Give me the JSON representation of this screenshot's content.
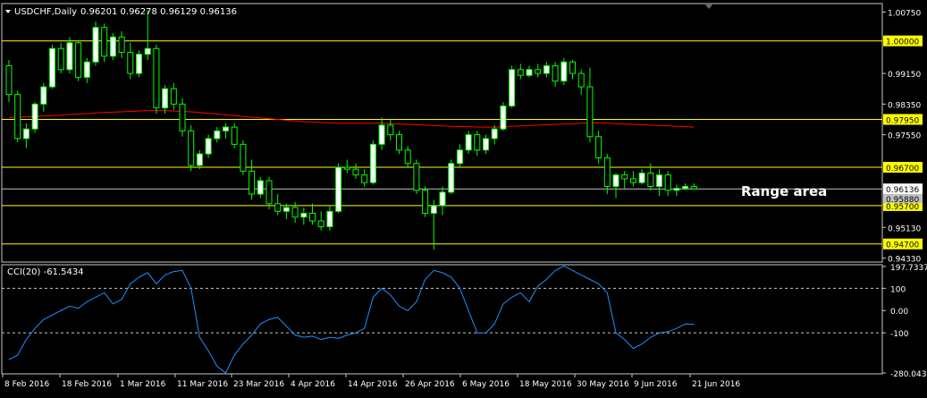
{
  "header": {
    "symbol_label": "USDCHF,Daily",
    "ohlc": "0.96201 0.96278 0.96129 0.96136",
    "menu_arrow": "triangle-down-icon"
  },
  "annotation": {
    "text": "Range area"
  },
  "colors": {
    "background": "#000000",
    "grid_border": "#c8c8c8",
    "bull_candle": "#ffffff",
    "bear_candle": "#000000",
    "candle_outline": "#00ff00",
    "moving_average": "#ff0000",
    "level_lines": "#ffff00",
    "price_line": "#c0c0c0",
    "cci_line": "#1e90ff",
    "text": "#ffffff"
  },
  "chart_data": [
    {
      "type": "candlestick",
      "title": "USDCHF,Daily",
      "ylim": [
        0.9425,
        1.0095
      ],
      "y_ticks": [
        "1.00750",
        "0.99150",
        "0.98350",
        "0.97550",
        "0.95130",
        "0.94330"
      ],
      "level_lines": [
        {
          "value": 1.0,
          "label": "1.00000"
        },
        {
          "value": 0.9795,
          "label": "0.97950"
        },
        {
          "value": 0.967,
          "label": "0.96700"
        },
        {
          "value": 0.957,
          "label": "0.95700"
        },
        {
          "value": 0.947,
          "label": "0.94700"
        }
      ],
      "current_price": {
        "value": 0.96136,
        "label": "0.96136"
      },
      "hidden_label": {
        "value": 0.9588,
        "label": "0.95880"
      },
      "x_labels": [
        "8 Feb 2016",
        "18 Feb 2016",
        "1 Mar 2016",
        "11 Mar 2016",
        "23 Mar 2016",
        "4 Apr 2016",
        "14 Apr 2016",
        "26 Apr 2016",
        "6 May 2016",
        "18 May 2016",
        "30 May 2016",
        "9 Jun 2016",
        "21 Jun 2016"
      ],
      "candles": [
        [
          0.9935,
          0.995,
          0.984,
          0.986
        ],
        [
          0.986,
          0.987,
          0.9735,
          0.9745
        ],
        [
          0.9745,
          0.9785,
          0.972,
          0.977
        ],
        [
          0.977,
          0.984,
          0.976,
          0.9835
        ],
        [
          0.9835,
          0.989,
          0.9815,
          0.988
        ],
        [
          0.988,
          0.999,
          0.9875,
          0.998
        ],
        [
          0.998,
          0.9995,
          0.9915,
          0.9925
        ],
        [
          0.9925,
          1.001,
          0.9915,
          0.9995
        ],
        [
          0.9995,
          1.0,
          0.9895,
          0.9905
        ],
        [
          0.9905,
          0.9955,
          0.989,
          0.9945
        ],
        [
          0.9945,
          1.005,
          0.9935,
          1.0035
        ],
        [
          1.0035,
          1.0045,
          0.9945,
          0.996
        ],
        [
          0.996,
          1.002,
          0.995,
          1.001
        ],
        [
          1.001,
          1.0025,
          0.9955,
          0.997
        ],
        [
          0.997,
          0.9995,
          0.99,
          0.9915
        ],
        [
          0.9915,
          0.9975,
          0.9905,
          0.9965
        ],
        [
          0.9965,
          1.008,
          0.995,
          0.998
        ],
        [
          0.998,
          0.999,
          0.981,
          0.9825
        ],
        [
          0.9825,
          0.9885,
          0.981,
          0.9875
        ],
        [
          0.9875,
          0.989,
          0.982,
          0.9835
        ],
        [
          0.9835,
          0.985,
          0.975,
          0.9765
        ],
        [
          0.9765,
          0.978,
          0.966,
          0.9675
        ],
        [
          0.9675,
          0.9715,
          0.9665,
          0.9705
        ],
        [
          0.9705,
          0.9755,
          0.9695,
          0.9745
        ],
        [
          0.9745,
          0.9775,
          0.9735,
          0.9765
        ],
        [
          0.9765,
          0.9785,
          0.9745,
          0.9775
        ],
        [
          0.9775,
          0.9785,
          0.972,
          0.973
        ],
        [
          0.973,
          0.974,
          0.965,
          0.966
        ],
        [
          0.966,
          0.969,
          0.9585,
          0.96
        ],
        [
          0.96,
          0.9645,
          0.959,
          0.9635
        ],
        [
          0.9635,
          0.9645,
          0.956,
          0.9575
        ],
        [
          0.9575,
          0.96,
          0.9545,
          0.9555
        ],
        [
          0.9555,
          0.9575,
          0.9535,
          0.9565
        ],
        [
          0.9565,
          0.958,
          0.9525,
          0.954
        ],
        [
          0.954,
          0.9565,
          0.952,
          0.955
        ],
        [
          0.955,
          0.9575,
          0.952,
          0.953
        ],
        [
          0.953,
          0.9555,
          0.9505,
          0.9515
        ],
        [
          0.9515,
          0.957,
          0.9505,
          0.9555
        ],
        [
          0.9555,
          0.968,
          0.955,
          0.967
        ],
        [
          0.967,
          0.969,
          0.9655,
          0.9665
        ],
        [
          0.9665,
          0.968,
          0.964,
          0.965
        ],
        [
          0.965,
          0.9665,
          0.962,
          0.963
        ],
        [
          0.963,
          0.974,
          0.9625,
          0.973
        ],
        [
          0.973,
          0.98,
          0.9715,
          0.978
        ],
        [
          0.978,
          0.9795,
          0.974,
          0.9755
        ],
        [
          0.9755,
          0.9765,
          0.9705,
          0.9715
        ],
        [
          0.9715,
          0.9725,
          0.967,
          0.968
        ],
        [
          0.968,
          0.969,
          0.96,
          0.961
        ],
        [
          0.961,
          0.962,
          0.954,
          0.955
        ],
        [
          0.955,
          0.9585,
          0.9455,
          0.957
        ],
        [
          0.957,
          0.962,
          0.9545,
          0.9605
        ],
        [
          0.9605,
          0.969,
          0.96,
          0.968
        ],
        [
          0.968,
          0.973,
          0.967,
          0.9715
        ],
        [
          0.9715,
          0.9765,
          0.9705,
          0.9755
        ],
        [
          0.9755,
          0.9765,
          0.97,
          0.9715
        ],
        [
          0.9715,
          0.9755,
          0.9705,
          0.9745
        ],
        [
          0.9745,
          0.978,
          0.973,
          0.977
        ],
        [
          0.977,
          0.984,
          0.9765,
          0.983
        ],
        [
          0.983,
          0.9935,
          0.9825,
          0.9925
        ],
        [
          0.9925,
          0.994,
          0.99,
          0.991
        ],
        [
          0.991,
          0.9935,
          0.9905,
          0.9925
        ],
        [
          0.9925,
          0.994,
          0.9905,
          0.9915
        ],
        [
          0.9915,
          0.9945,
          0.9905,
          0.9935
        ],
        [
          0.9935,
          0.9945,
          0.988,
          0.9895
        ],
        [
          0.9895,
          0.9955,
          0.9885,
          0.9945
        ],
        [
          0.9945,
          0.995,
          0.99,
          0.9915
        ],
        [
          0.9915,
          0.9925,
          0.986,
          0.988
        ],
        [
          0.988,
          0.993,
          0.9735,
          0.975
        ],
        [
          0.975,
          0.9765,
          0.968,
          0.9695
        ],
        [
          0.9695,
          0.9705,
          0.96,
          0.962
        ],
        [
          0.962,
          0.9655,
          0.959,
          0.965
        ],
        [
          0.965,
          0.966,
          0.9615,
          0.964
        ],
        [
          0.964,
          0.966,
          0.962,
          0.963
        ],
        [
          0.963,
          0.9665,
          0.9625,
          0.9655
        ],
        [
          0.9655,
          0.968,
          0.961,
          0.962
        ],
        [
          0.962,
          0.9665,
          0.9595,
          0.965
        ],
        [
          0.965,
          0.966,
          0.9595,
          0.961
        ],
        [
          0.961,
          0.9625,
          0.9595,
          0.9615
        ],
        [
          0.9615,
          0.9628,
          0.961,
          0.962
        ],
        [
          0.962,
          0.9628,
          0.9612,
          0.9614
        ]
      ],
      "moving_average": [
        0.98,
        0.9801,
        0.9802,
        0.9803,
        0.9804,
        0.9805,
        0.9806,
        0.9808,
        0.9809,
        0.981,
        0.9812,
        0.9813,
        0.9814,
        0.9815,
        0.9816,
        0.9817,
        0.9818,
        0.9818,
        0.9818,
        0.9817,
        0.9816,
        0.9815,
        0.9813,
        0.9811,
        0.9809,
        0.9807,
        0.9805,
        0.9803,
        0.9801,
        0.9799,
        0.9797,
        0.9795,
        0.9793,
        0.9791,
        0.9789,
        0.9788,
        0.9787,
        0.9786,
        0.9785,
        0.9785,
        0.9785,
        0.9785,
        0.9785,
        0.9785,
        0.9784,
        0.9783,
        0.9782,
        0.9781,
        0.978,
        0.9779,
        0.9778,
        0.9777,
        0.9776,
        0.9776,
        0.9775,
        0.9775,
        0.9775,
        0.9776,
        0.9777,
        0.9778,
        0.9779,
        0.978,
        0.9781,
        0.9782,
        0.9783,
        0.9784,
        0.9785,
        0.9786,
        0.9786,
        0.9785,
        0.9784,
        0.9783,
        0.9782,
        0.9781,
        0.978,
        0.9779,
        0.9778,
        0.9777,
        0.9776,
        0.9775
      ]
    },
    {
      "type": "line",
      "title": "CCI(20) -61.5434",
      "ylim": [
        -280.0437,
        197.7337
      ],
      "y_ticks": [
        "197.7337",
        "100",
        "0.00",
        "-100",
        "-280.0437"
      ],
      "levels": [
        100,
        -100
      ],
      "series": [
        {
          "name": "CCI(20)",
          "values": [
            -220,
            -200,
            -130,
            -80,
            -40,
            -20,
            0,
            20,
            10,
            40,
            60,
            80,
            30,
            50,
            120,
            150,
            170,
            120,
            160,
            175,
            180,
            100,
            -120,
            -180,
            -250,
            -280,
            -200,
            -150,
            -110,
            -60,
            -40,
            -30,
            -70,
            -110,
            -120,
            -115,
            -130,
            -120,
            -125,
            -110,
            -100,
            -80,
            60,
            100,
            70,
            20,
            0,
            40,
            140,
            180,
            170,
            150,
            100,
            0,
            -100,
            -100,
            -60,
            30,
            60,
            80,
            40,
            110,
            140,
            180,
            200,
            180,
            160,
            140,
            120,
            80,
            -100,
            -130,
            -170,
            -150,
            -120,
            -100,
            -95,
            -80,
            -60,
            -61
          ]
        }
      ]
    }
  ]
}
